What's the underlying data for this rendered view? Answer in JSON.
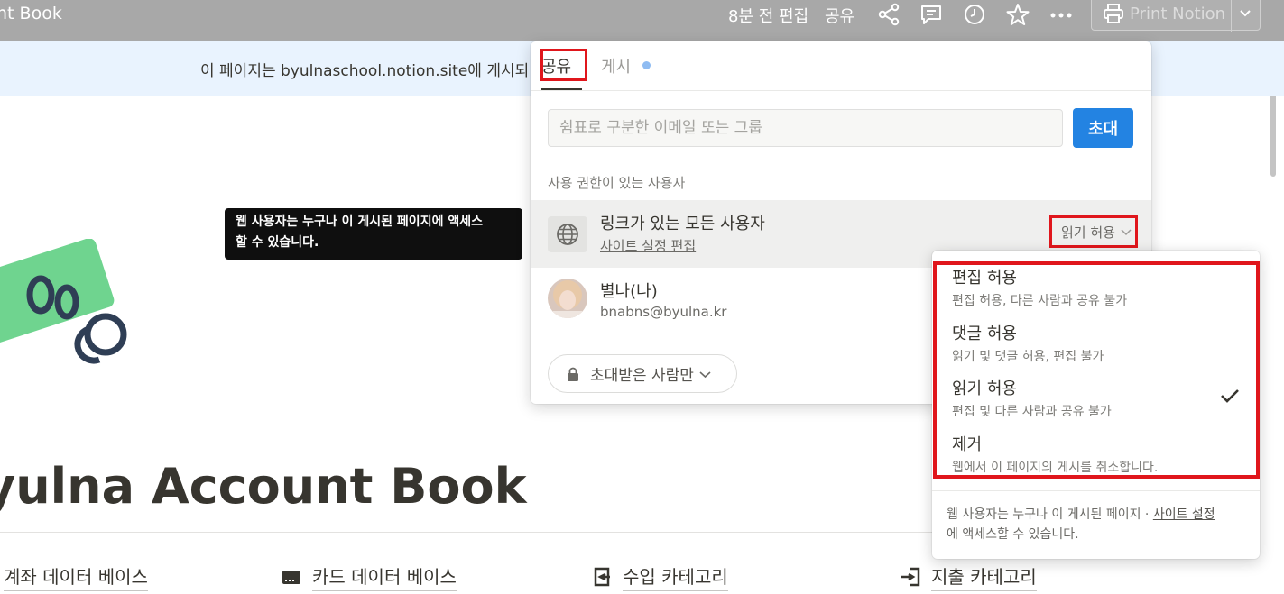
{
  "topbar": {
    "title": "nt Book",
    "edited": "8분 전 편집",
    "share": "공유",
    "print_label": "Print Notion"
  },
  "banner": {
    "text": "이 페이지는 byulnaschool.notion.site에 게시되"
  },
  "tooltip": {
    "line1": "웹 사용자는 누구나 이 게시된 페이지에 액세스",
    "line2": "할 수 있습니다."
  },
  "page": {
    "title": "yulna Account Book",
    "links": [
      {
        "label": "계좌 데이터 베이스",
        "icon": "bank-icon"
      },
      {
        "label": "카드 데이터 베이스",
        "icon": "card-icon"
      },
      {
        "label": "수입 카테고리",
        "icon": "income-icon"
      },
      {
        "label": "지출 카테고리",
        "icon": "expense-icon"
      }
    ]
  },
  "share_popup": {
    "tab_share": "공유",
    "tab_publish": "게시",
    "email_placeholder": "쉼표로 구분한 이메일 또는 그룹",
    "invite_label": "초대",
    "section_label": "사용 권한이 있는 사용자",
    "anyone_title": "링크가 있는 모든 사용자",
    "anyone_sub": "사이트 설정 편집",
    "anyone_permission": "읽기 허용",
    "me_name": "별나(나)",
    "me_email": "bnabns@byulna.kr",
    "invited_only": "초대받은 사람만"
  },
  "permission_menu": {
    "items": [
      {
        "title": "편집 허용",
        "desc": "편집 허용, 다른 사람과 공유 불가"
      },
      {
        "title": "댓글 허용",
        "desc": "읽기 및 댓글 허용, 편집 불가"
      },
      {
        "title": "읽기 허용",
        "desc": "편집 및 다른 사람과 공유 불가"
      },
      {
        "title": "제거",
        "desc": "웹에서 이 페이지의 게시를 취소합니다."
      }
    ],
    "footer_text": "웹 사용자는 누구나 이 게시된 페이지",
    "footer_link": "사이트 설정",
    "footer_text2": "에 액세스할 수 있습니다."
  },
  "colors": {
    "highlight_red": "#e0161c",
    "accent_blue": "#2383e2",
    "banner_bg": "#e9f3fe"
  }
}
